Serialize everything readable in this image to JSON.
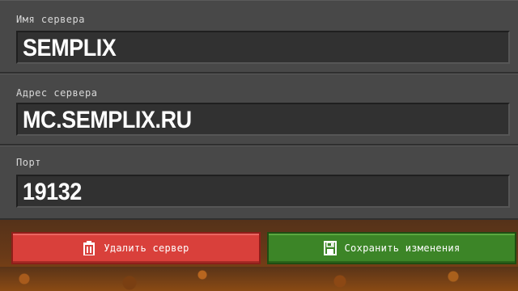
{
  "form": {
    "server_name": {
      "label": "Имя сервера",
      "value": "SEMPLIX"
    },
    "server_address": {
      "label": "Адрес сервера",
      "value": "MC.SEMPLIX.RU"
    },
    "port": {
      "label": "Порт",
      "value": "19132"
    }
  },
  "buttons": {
    "delete": {
      "label": "Удалить сервер",
      "icon": "trash-icon",
      "color": "#d9403b"
    },
    "save": {
      "label": "Сохранить изменения",
      "icon": "floppy-disk-icon",
      "color": "#3c8527"
    }
  }
}
